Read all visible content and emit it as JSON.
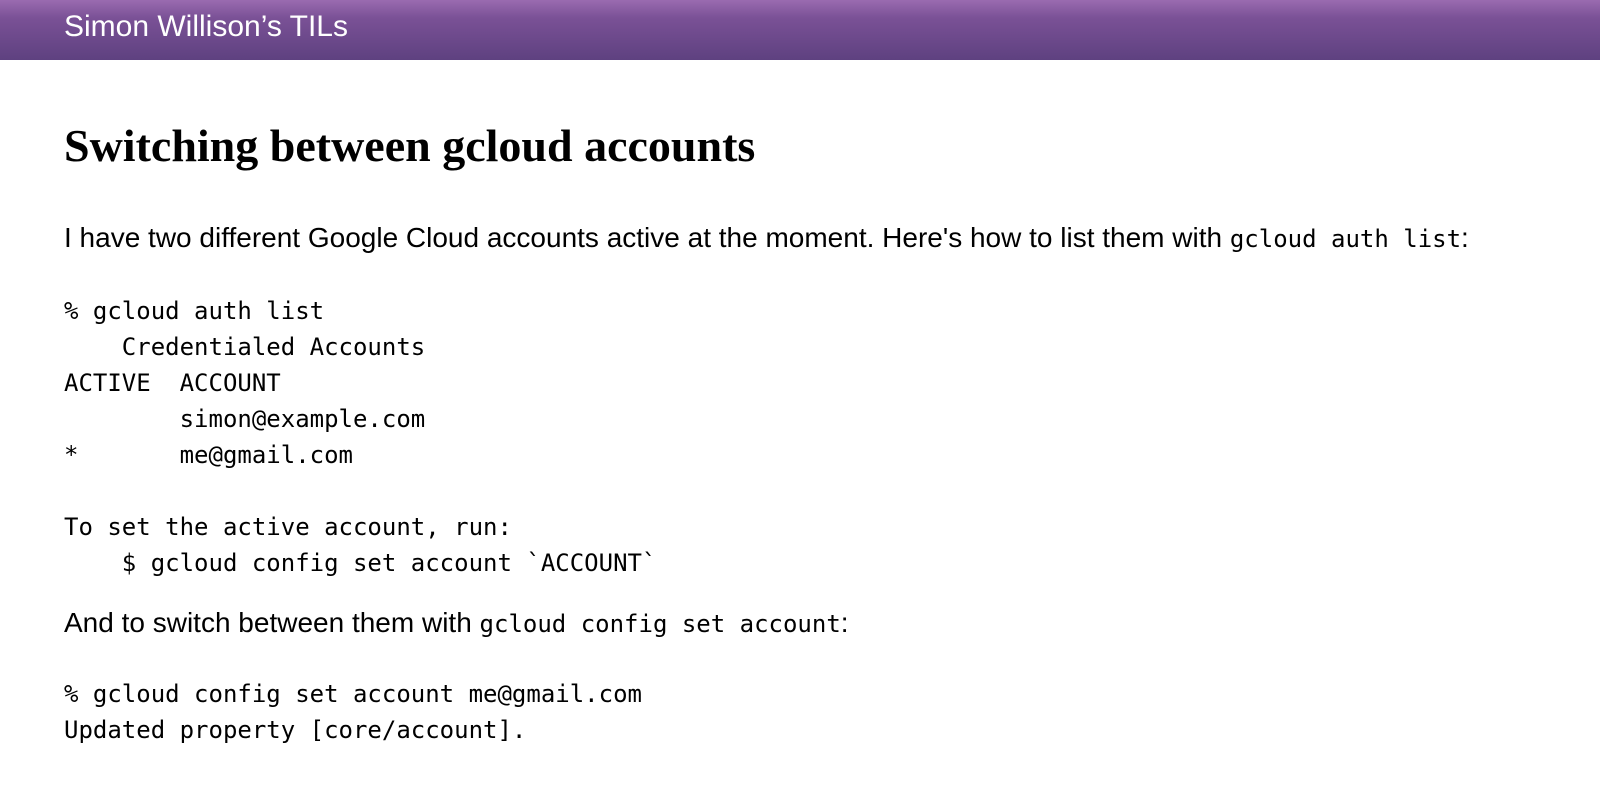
{
  "header": {
    "site_title": "Simon Willison’s TILs"
  },
  "article": {
    "title": "Switching between gcloud accounts",
    "intro_text": "I have two different Google Cloud accounts active at the moment. Here's how to list them with ",
    "intro_code": "gcloud auth list",
    "intro_suffix": ":",
    "code_block_1": "% gcloud auth list\n    Credentialed Accounts\nACTIVE  ACCOUNT\n        simon@example.com\n*       me@gmail.com\n\nTo set the active account, run:\n    $ gcloud config set account `ACCOUNT`",
    "switch_text": "And to switch between them with ",
    "switch_code": "gcloud config set account",
    "switch_suffix": ":",
    "code_block_2": "% gcloud config set account me@gmail.com\nUpdated property [core/account]."
  }
}
